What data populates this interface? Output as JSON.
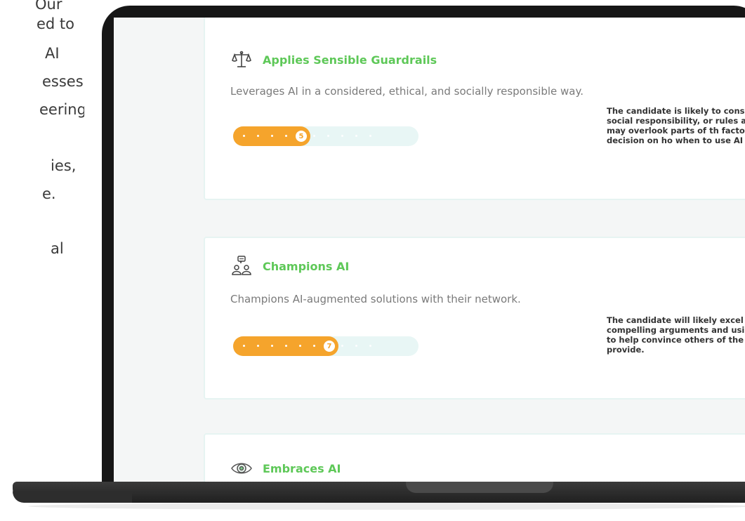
{
  "side_text": [
    "Our",
    "ed to",
    "AI",
    "esses",
    "eering,",
    "",
    "ies,",
    "e.",
    "",
    "al"
  ],
  "cards": [
    {
      "title": "Applies Sensible Guardrails",
      "icon": "balance-scale-icon",
      "description": "Leverages AI in a considered, ethical, and socially responsible way.",
      "score": 5,
      "score_max": 10,
      "comment": "The candidate is likely to consider organ risks, social responsibility, or rules and regulations, but may overlook parts of th factors when making the decision on ho when to use AI tools."
    },
    {
      "title": "Champions AI",
      "icon": "people-speech-icon",
      "description": "Champions AI-augmented solutions with their network.",
      "score": 7,
      "score_max": 10,
      "comment": "The candidate will likely excel at crafting compelling arguments and using a wide strategies to help convince others of the that AI solutions provide."
    },
    {
      "title": "Embraces AI",
      "icon": "eye-icon",
      "description": "",
      "score": null,
      "score_max": 10,
      "comment": ""
    }
  ],
  "colors": {
    "accent_green": "#5ec858",
    "score_orange": "#f5a42c",
    "bar_track": "#e8f6f5",
    "laptop_frame": "#161616"
  }
}
